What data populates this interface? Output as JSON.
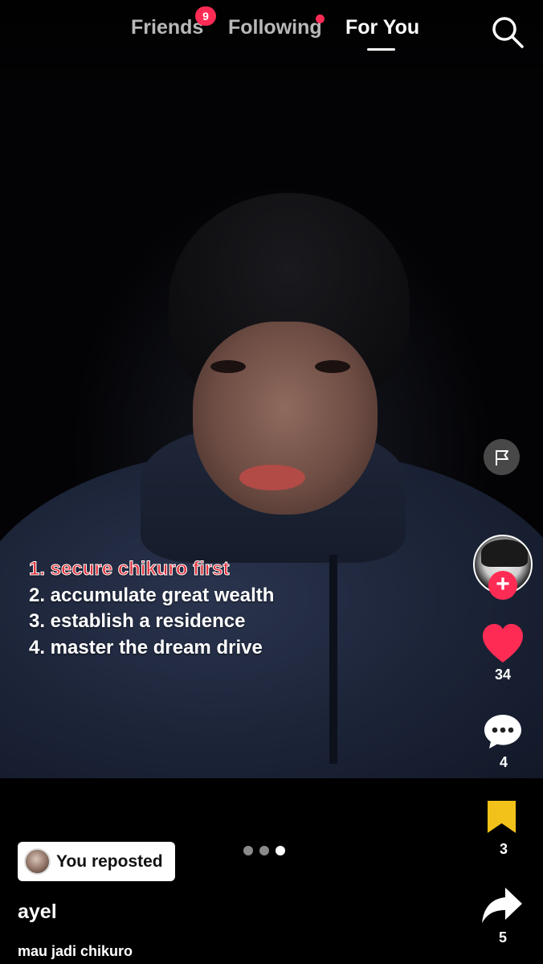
{
  "top_nav": {
    "tabs": [
      {
        "label": "Friends",
        "badge": "9"
      },
      {
        "label": "Following"
      },
      {
        "label": "For You",
        "active": true
      }
    ],
    "search_icon": "search-icon"
  },
  "video": {
    "caption_lines": [
      "1. secure chikuro first",
      "2. accumulate great wealth",
      "3. establish a residence",
      "4. master the dream drive"
    ],
    "carousel_pages": 3,
    "carousel_active_index": 2
  },
  "actions": {
    "report_icon": "flag-icon",
    "like_count": "34",
    "comment_count": "4",
    "bookmark_count": "3",
    "share_count": "5"
  },
  "post": {
    "repost_label": "You reposted",
    "username": "ayel",
    "description": "mau jadi chikuro"
  },
  "colors": {
    "accent": "#fe2c55",
    "bookmark": "#f2c21b",
    "caption_highlight": "#e0323c"
  }
}
